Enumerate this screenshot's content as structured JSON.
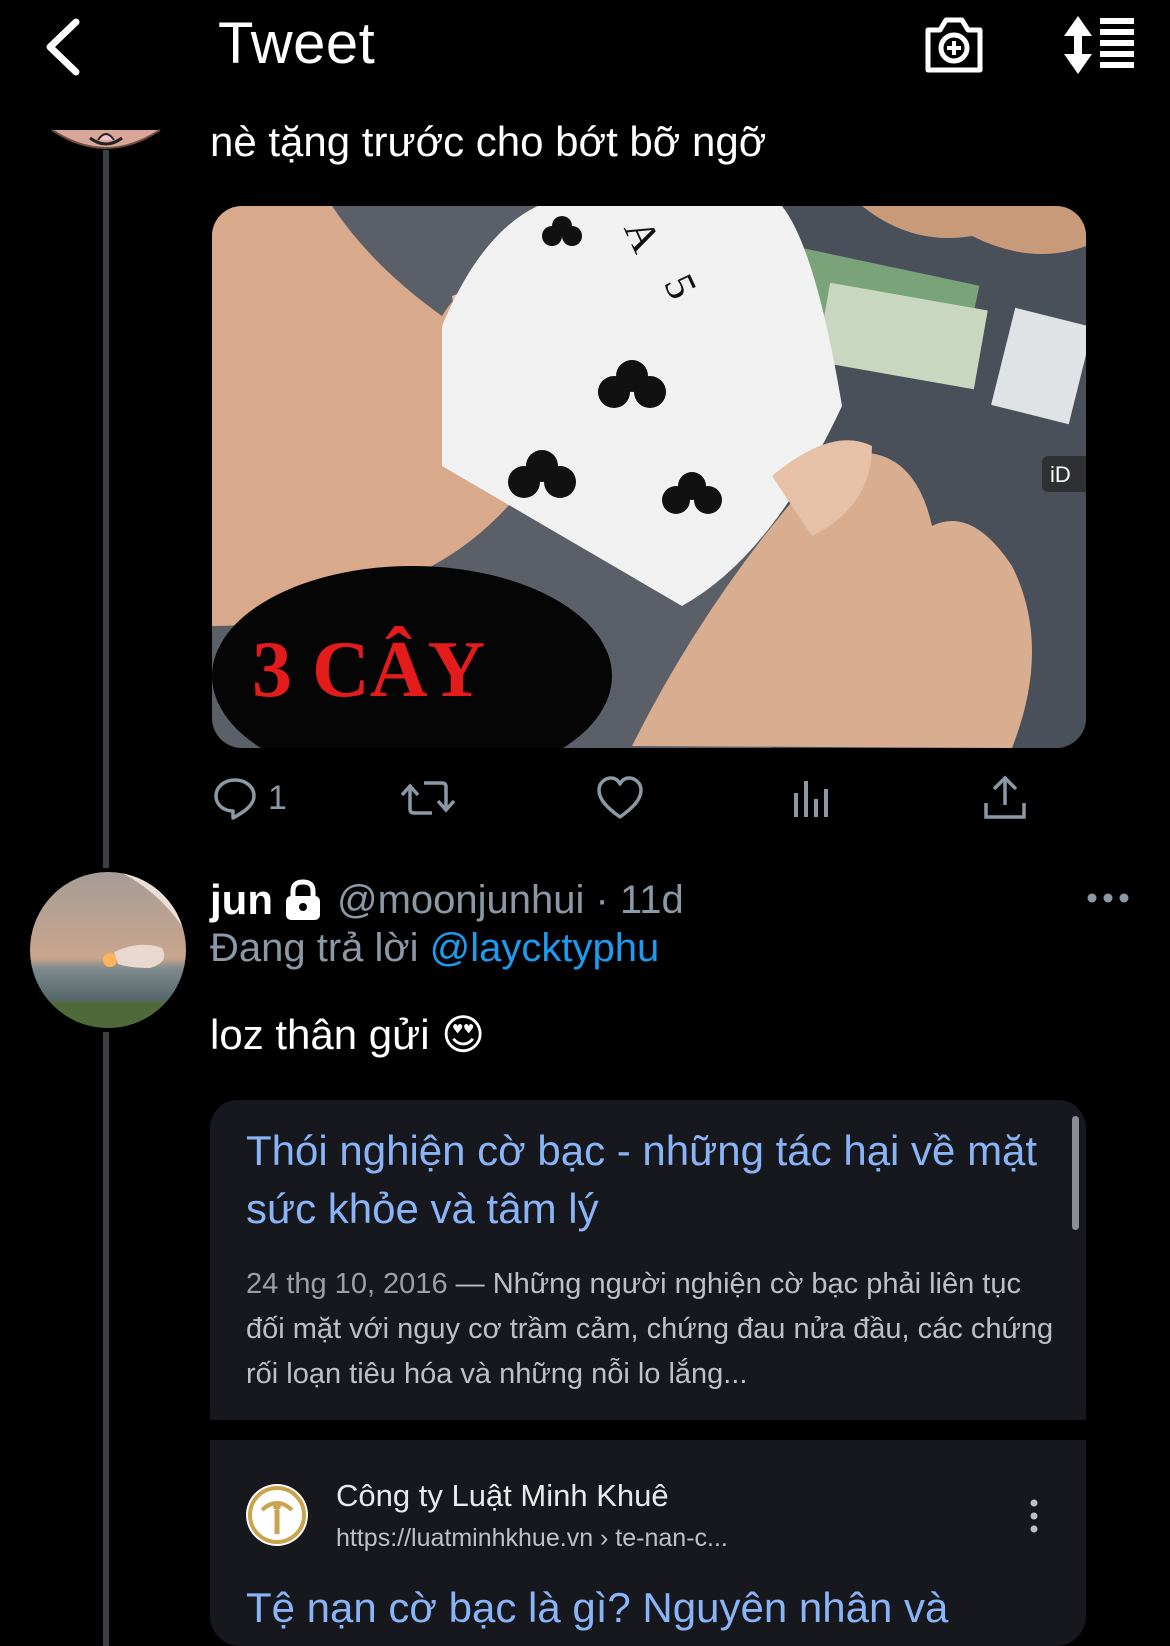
{
  "header": {
    "title": "Tweet",
    "back_icon": "chevron-left-icon",
    "camera_icon": "camera-plus-icon",
    "sort_icon": "sort-list-icon"
  },
  "previous_tweet": {
    "text": "nè tặng trước cho bớt bỡ ngỡ",
    "media_caption": "3 CÂY",
    "media_watermark": "iD",
    "actions": {
      "reply_count": "1"
    }
  },
  "reply_tweet": {
    "display_name": "jun",
    "handle_time": "@moonjunhui · 11d",
    "reply_prefix": "Đang trả lời",
    "reply_to": "@laycktyphu",
    "text": "loz thân gửi",
    "emoji": "😍"
  },
  "search_card": {
    "title": "Thói nghiện cờ bạc - những tác hại về mặt sức khỏe và tâm lý",
    "date": "24 thg 10, 2016",
    "snippet": " — Những người nghiện cờ bạc phải liên tục đối mặt với nguy cơ trầm cảm, chứng đau nửa đầu, các chứng rối loạn tiêu hóa và những nỗi lo lắng..."
  },
  "search_card2": {
    "site_name": "Công ty Luật Minh Khuê",
    "url": "https://luatminhkhue.vn › te-nan-c...",
    "title": "Tệ nạn cờ bạc là gì? Nguyên nhân và"
  },
  "colors": {
    "background": "#000000",
    "link": "#1d9bf0",
    "google_link": "#8ab4f8",
    "muted": "#8b98a5"
  }
}
